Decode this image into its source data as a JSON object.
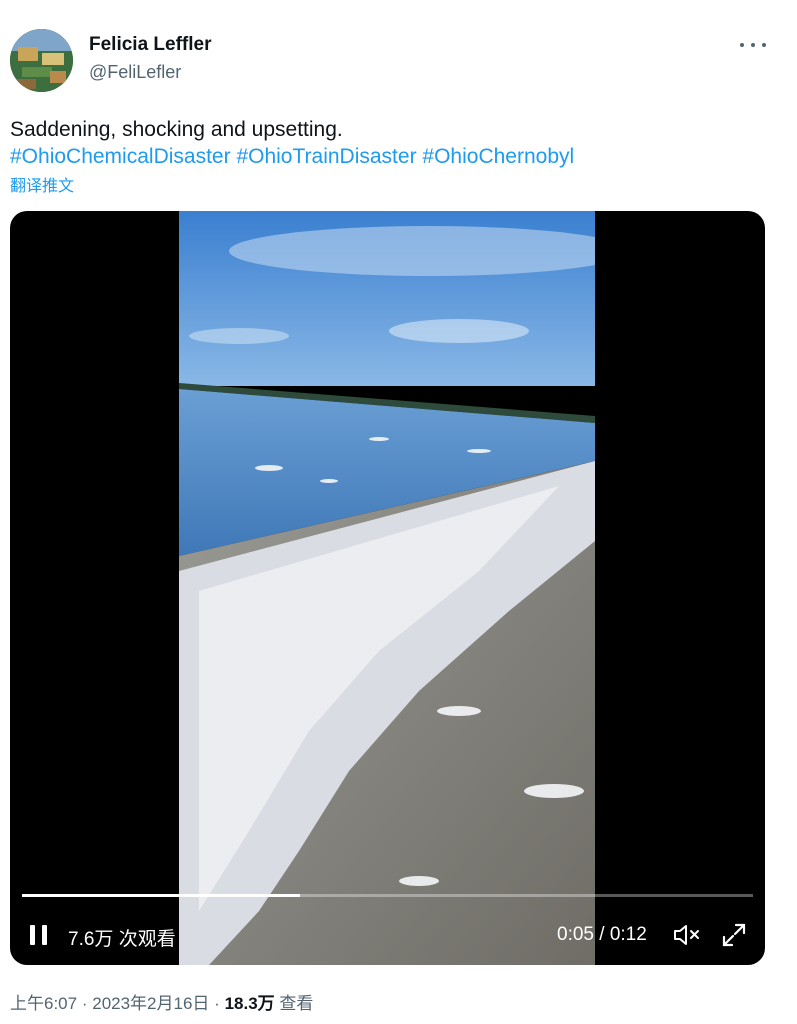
{
  "author": {
    "name": "Felicia Leffler",
    "handle": "@FeliLefler"
  },
  "tweet": {
    "text": "Saddening, shocking and upsetting.",
    "hashtags": [
      "#OhioChemicalDisaster",
      "#OhioTrainDisaster",
      "#OhioChernobyl"
    ],
    "translate_label": "翻译推文"
  },
  "video": {
    "views_label": "7.6万 次观看",
    "time_label": "0:05 / 0:12",
    "progress": 0.38
  },
  "meta": {
    "time": "上午6:07",
    "separator": "·",
    "date": "2023年2月16日",
    "views_count": "18.3万",
    "views_label": "查看"
  },
  "icons": {
    "more": "more-horizontal-icon",
    "pause": "pause-icon",
    "mute": "volume-muted-icon",
    "fullscreen": "fullscreen-icon"
  },
  "colors": {
    "link": "#1d9bf0",
    "secondary_text": "#536471",
    "primary_text": "#0f1419"
  }
}
